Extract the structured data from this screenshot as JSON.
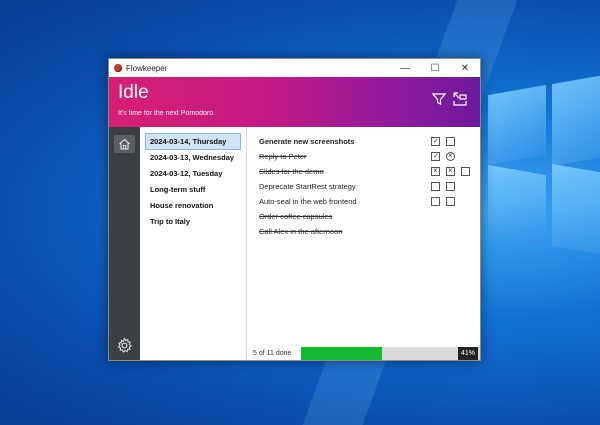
{
  "window": {
    "title": "Flowkeeper",
    "min": "—",
    "max": "☐",
    "close": "✕"
  },
  "header": {
    "title": "Idle",
    "subtitle": "It's time for the next Pomodoro."
  },
  "backlogs": [
    {
      "label": "2024-03-14, Thursday"
    },
    {
      "label": "2024-03-13, Wednesday"
    },
    {
      "label": "2024-03-12, Tuesday"
    },
    {
      "label": "Long-term stuff"
    },
    {
      "label": "House renovation"
    },
    {
      "label": "Trip to Italy"
    }
  ],
  "tasks": [
    {
      "text": "Generate new screenshots",
      "style": "bold",
      "pomodoros": [
        "check",
        "empty"
      ]
    },
    {
      "text": "Reply to Peter",
      "style": "done",
      "pomodoros": [
        "check",
        "voided"
      ]
    },
    {
      "text": "Slides for the demo",
      "style": "done",
      "pomodoros": [
        "cross",
        "cross",
        "empty"
      ]
    },
    {
      "text": "Deprecate StartRest strategy",
      "style": "normal",
      "pomodoros": [
        "empty",
        "empty"
      ]
    },
    {
      "text": "Auto-seal in the web frontend",
      "style": "normal",
      "pomodoros": [
        "empty",
        "empty"
      ]
    },
    {
      "text": "Order coffee capsules",
      "style": "done",
      "pomodoros": []
    },
    {
      "text": "Call Alex in the afternoon",
      "style": "done",
      "pomodoros": []
    }
  ],
  "status": {
    "done_text": "5 of 11 done",
    "progress_label": "41%",
    "progress_fraction": 0.45
  },
  "colors": {
    "header_start": "#d81f72",
    "header_end": "#6d1a9c",
    "progress": "#13b92e"
  },
  "icons": {
    "filter": "filter-icon",
    "switch": "switch-view-icon",
    "home": "home-icon",
    "settings": "gear-icon"
  }
}
